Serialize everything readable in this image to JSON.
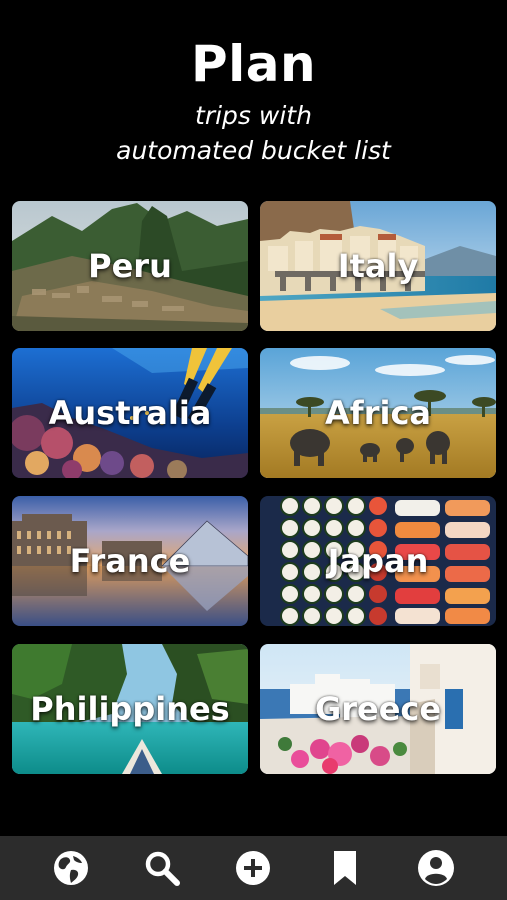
{
  "header": {
    "title": "Plan",
    "subtitle_line1": "trips with",
    "subtitle_line2": "automated bucket list"
  },
  "destinations": [
    {
      "name": "Peru"
    },
    {
      "name": "Italy"
    },
    {
      "name": "Australia"
    },
    {
      "name": "Africa"
    },
    {
      "name": "France"
    },
    {
      "name": "Japan"
    },
    {
      "name": "Philippines"
    },
    {
      "name": "Greece"
    }
  ],
  "tabbar": {
    "items": [
      {
        "icon": "globe-icon"
      },
      {
        "icon": "search-icon"
      },
      {
        "icon": "add-circle-icon"
      },
      {
        "icon": "bookmark-icon"
      },
      {
        "icon": "profile-icon"
      }
    ]
  },
  "colors": {
    "background": "#000000",
    "tabbar": "#2c2c2c",
    "text": "#ffffff"
  }
}
